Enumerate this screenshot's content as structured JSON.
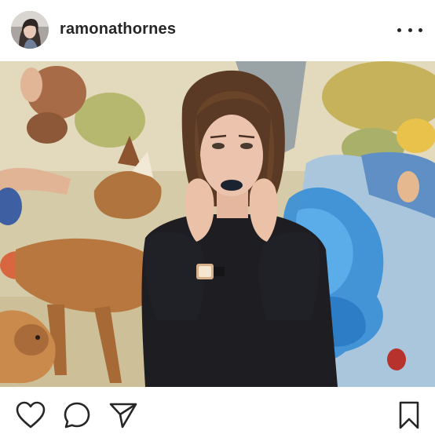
{
  "post": {
    "username": "ramonathornes"
  },
  "icons": {
    "more": "more-options-icon",
    "like": "heart-icon",
    "comment": "comment-bubble-icon",
    "share": "paper-plane-icon",
    "save": "bookmark-icon"
  },
  "colors": {
    "text": "#262626",
    "background": "#ffffff",
    "smoke_blue": "#3a8fd8",
    "mural_beige": "#d9cfae"
  }
}
